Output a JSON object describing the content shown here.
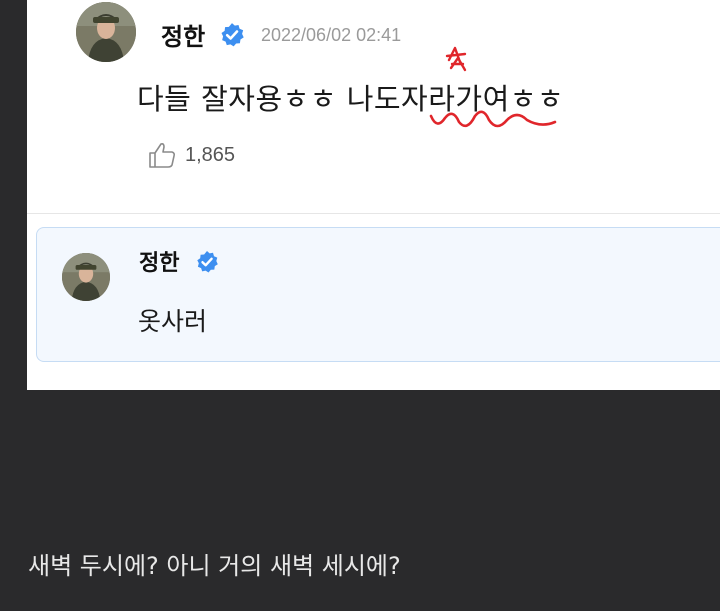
{
  "post": {
    "author": "정한",
    "verified_icon": "verified-badge-icon",
    "timestamp": "2022/06/02 02:41",
    "text": "다들 잘자용ㅎㅎ 나도자라가여ㅎㅎ",
    "like_icon": "thumbs-up-icon",
    "like_count": "1,865"
  },
  "reply": {
    "author": "정한",
    "verified_icon": "verified-badge-icon",
    "text": "옷사러"
  },
  "caption": "새벽 두시에? 아니 거의 새벽 세시에?",
  "colors": {
    "badge": "#3d8ff0",
    "scribble": "#e0262b",
    "reply_background": "#f3f8fe",
    "reply_border": "#c6dcf4",
    "page_background": "#2a2a2c"
  }
}
